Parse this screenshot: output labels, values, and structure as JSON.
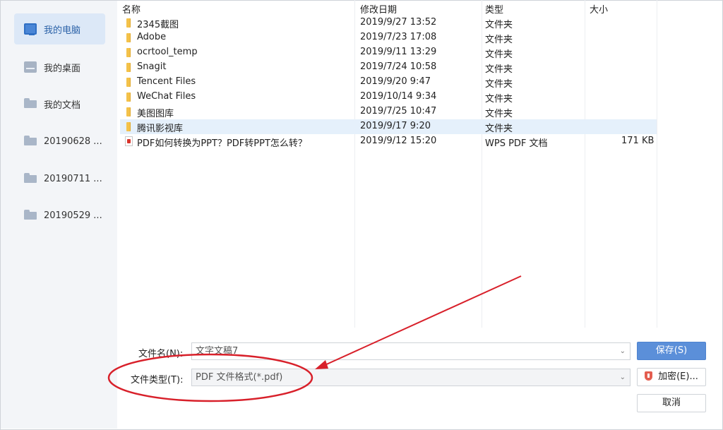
{
  "sidebar": {
    "items": [
      {
        "label": "我的电脑",
        "icon": "computer-icon"
      },
      {
        "label": "我的桌面",
        "icon": "desktop-icon"
      },
      {
        "label": "我的文档",
        "icon": "folder-icon"
      },
      {
        "label": "20190628 ...",
        "icon": "folder-icon"
      },
      {
        "label": "20190711 ...",
        "icon": "folder-icon"
      },
      {
        "label": "20190529 ...",
        "icon": "folder-icon"
      }
    ]
  },
  "columns": {
    "name": "名称",
    "modified": "修改日期",
    "type": "类型",
    "size": "大小"
  },
  "files": [
    {
      "name": "2345截图",
      "modified": "2019/9/27 13:52",
      "type": "文件夹",
      "size": "",
      "icon": "folder-icon"
    },
    {
      "name": "Adobe",
      "modified": "2019/7/23 17:08",
      "type": "文件夹",
      "size": "",
      "icon": "folder-icon"
    },
    {
      "name": "ocrtool_temp",
      "modified": "2019/9/11 13:29",
      "type": "文件夹",
      "size": "",
      "icon": "folder-icon"
    },
    {
      "name": "Snagit",
      "modified": "2019/7/24 10:58",
      "type": "文件夹",
      "size": "",
      "icon": "folder-icon"
    },
    {
      "name": "Tencent Files",
      "modified": "2019/9/20 9:47",
      "type": "文件夹",
      "size": "",
      "icon": "folder-icon"
    },
    {
      "name": "WeChat Files",
      "modified": "2019/10/14 9:34",
      "type": "文件夹",
      "size": "",
      "icon": "folder-icon"
    },
    {
      "name": "美图图库",
      "modified": "2019/7/25 10:47",
      "type": "文件夹",
      "size": "",
      "icon": "folder-icon"
    },
    {
      "name": "腾讯影视库",
      "modified": "2019/9/17 9:20",
      "type": "文件夹",
      "size": "",
      "icon": "folder-icon"
    },
    {
      "name": "PDF如何转换为PPT？PDF转PPT怎么转？",
      "modified": "2019/9/12 15:20",
      "type": "WPS PDF 文档",
      "size": "171 KB",
      "icon": "pdf-file-icon"
    }
  ],
  "form": {
    "filename_label": "文件名(N):",
    "filename_value": "文字文稿7",
    "filetype_label": "文件类型(T):",
    "filetype_value": "PDF 文件格式(*.pdf)",
    "dropdown_glyph": "⌄"
  },
  "buttons": {
    "save": "保存(S)",
    "encrypt": "加密(E)...",
    "cancel": "取消"
  },
  "colors": {
    "annotation": "#d8202a",
    "primary": "#5b8fd9",
    "selected_row": "#e5f0fb",
    "sidebar_active": "#dce8f7"
  }
}
